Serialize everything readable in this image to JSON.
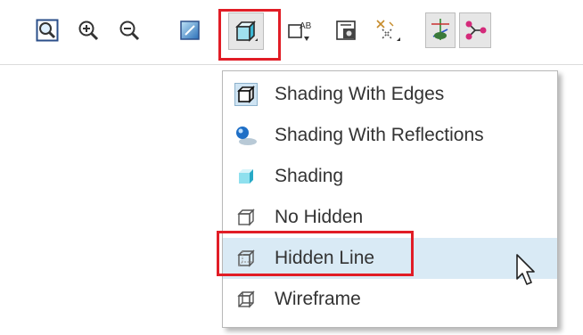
{
  "toolbar": {
    "tools": [
      {
        "name": "refit-icon"
      },
      {
        "name": "zoom-in-icon"
      },
      {
        "name": "zoom-out-icon"
      },
      {
        "name": "repaint-icon"
      },
      {
        "name": "display-style-icon"
      },
      {
        "name": "annotation-display-icon"
      },
      {
        "name": "saved-orientations-icon"
      },
      {
        "name": "datum-display-icon"
      },
      {
        "name": "spin-center-icon"
      },
      {
        "name": "view-manager-icon"
      }
    ]
  },
  "menu": {
    "items": [
      {
        "label": "Shading With Edges",
        "icon": "shading-with-edges-icon",
        "active": true
      },
      {
        "label": "Shading With Reflections",
        "icon": "shading-with-reflections-icon"
      },
      {
        "label": "Shading",
        "icon": "shading-icon"
      },
      {
        "label": "No Hidden",
        "icon": "no-hidden-icon"
      },
      {
        "label": "Hidden Line",
        "icon": "hidden-line-icon",
        "hover": true
      },
      {
        "label": "Wireframe",
        "icon": "wireframe-icon"
      }
    ]
  },
  "colors": {
    "highlight_border": "#e11d26",
    "hover_bg": "#d9eaf5",
    "text": "#333333"
  }
}
